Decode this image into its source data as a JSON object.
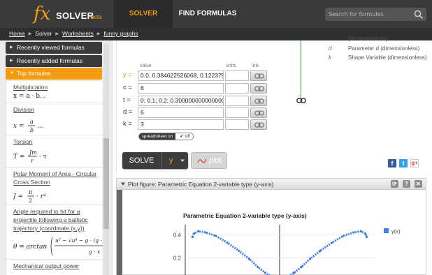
{
  "header": {
    "logo_fx": "fx",
    "logo_name": "SOLVER",
    "logo_beta": "beta",
    "nav": [
      "SOLVER",
      "FIND FORMULAS"
    ],
    "search_placeholder": "Search for formulas",
    "search_icon": "search-icon",
    "accent_color": "#f39c12"
  },
  "breadcrumb": [
    "Home",
    "Solver",
    "Worksheets",
    "funny graphs"
  ],
  "sidebar": {
    "sections": [
      "Recently viewed formulas",
      "Recently added formulas",
      "Top formulas"
    ],
    "formulas": [
      {
        "title": "Multiplication",
        "expr": "x = a · b..."
      },
      {
        "title": "Division",
        "expr": "x = a / b ..."
      },
      {
        "title": "Torsion",
        "expr": "T = (Jт / r) · τ"
      },
      {
        "title": "Polar Moment of Area - Circular Cross Section",
        "expr": "J = (π / 2) · r⁴"
      },
      {
        "title": "Angle required to hit for a projectile following a ballistic trajectory (coordinate (x,y))",
        "expr": "θ = arctan( (u² − √(u⁴ − g·(g·x ...)) / (g·x) )"
      },
      {
        "title": "Mechanical output power",
        "expr": ""
      }
    ]
  },
  "variables_legend": [
    {
      "sym": "",
      "desc": "(dimensionless)"
    },
    {
      "sym": "d",
      "desc": "Parameter d (dimensionless)"
    },
    {
      "sym": "k",
      "desc": "Shape Variable (dimensionless)"
    }
  ],
  "grid": {
    "col_value": "value",
    "col_units": "units",
    "col_link": "link",
    "rows": [
      {
        "label": "y =",
        "value": "0.0, 0.384622526068, 0.122379 ..."
      },
      {
        "label": "c =",
        "value": "6"
      },
      {
        "label": "t =",
        "value": "0; 0.1; 0.2; 0.300000000000000"
      },
      {
        "label": "d =",
        "value": "6"
      },
      {
        "label": "k =",
        "value": "3"
      }
    ],
    "spreadsheet_label": "spreadsheet on",
    "spreadsheet_state": "off"
  },
  "actions": {
    "solve": "SOLVE",
    "solve_var": "y",
    "plot": "plot"
  },
  "share": {
    "fb": "f",
    "tw": "t",
    "gp": "g+"
  },
  "plot_panel": {
    "title": "Plot figure: Parametric Equation 2-variable type (y-axis)",
    "buttons": [
      "⟳",
      "?",
      "✕"
    ]
  },
  "chart_data": {
    "type": "line",
    "title": "Parametric Equation 2-variable type (y-axis)",
    "legend": [
      "y(x)"
    ],
    "legend_position": "top-right",
    "yticks": [
      0.4,
      0.2
    ],
    "ylim_visible": [
      0.05,
      0.45
    ],
    "series": [
      {
        "name": "y(x)",
        "color": "#3d7fe6",
        "points_x": [
          -6.0,
          -5.9,
          -5.6,
          -5.1,
          -4.4,
          -3.6,
          -2.8,
          -2.1,
          -1.5,
          -1.0,
          -0.5,
          0.0,
          0.5,
          1.0,
          1.5,
          2.1,
          2.8,
          3.6,
          4.4,
          5.1,
          5.6,
          5.9,
          6.0
        ],
        "points_y": [
          0.38,
          0.41,
          0.43,
          0.42,
          0.39,
          0.33,
          0.26,
          0.19,
          0.12,
          0.07,
          0.03,
          0.0,
          0.03,
          0.07,
          0.12,
          0.19,
          0.26,
          0.33,
          0.39,
          0.42,
          0.43,
          0.41,
          0.38
        ]
      }
    ]
  }
}
